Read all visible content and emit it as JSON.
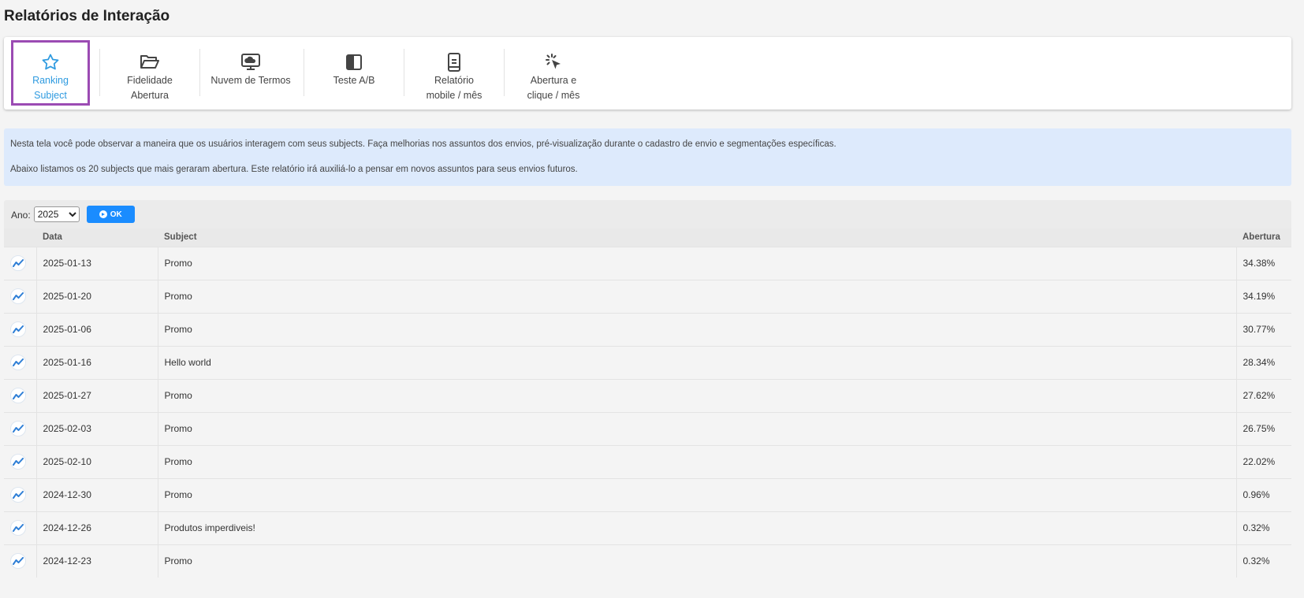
{
  "page": {
    "title": "Relatórios de Interação"
  },
  "tabs": [
    {
      "label": "Ranking\nSubject",
      "icon": "star-icon",
      "active": true
    },
    {
      "label": "Fidelidade\nAbertura",
      "icon": "folder-open-icon",
      "active": false
    },
    {
      "label": "Nuvem de Termos",
      "icon": "cloud-monitor-icon",
      "active": false
    },
    {
      "label": "Teste A/B",
      "icon": "split-square-icon",
      "active": false
    },
    {
      "label": "Relatório\nmobile / mês",
      "icon": "mobile-icon",
      "active": false
    },
    {
      "label": "Abertura e\nclique / mês",
      "icon": "cursor-click-icon",
      "active": false
    }
  ],
  "info": {
    "line1": "Nesta tela você pode observar a maneira que os usuários interagem com seus subjects. Faça melhorias nos assuntos dos envios, pré-visualização durante o cadastro de envio e segmentações específicas.",
    "line2": "Abaixo listamos os 20 subjects que mais geraram abertura. Este relatório irá auxiliá-lo a pensar em novos assuntos para seus envios futuros."
  },
  "filter": {
    "year_label": "Ano:",
    "year_value": "2025",
    "ok_label": "OK"
  },
  "colors": {
    "active_tab_border": "#9b4bb3",
    "active_tab_text": "#2f9be0",
    "ok_button": "#1a8cff",
    "info_bg": "#ddeafc"
  },
  "table": {
    "headers": {
      "date": "Data",
      "subject": "Subject",
      "opens": "Abertura"
    },
    "rows": [
      {
        "date": "2025-01-13",
        "subject": "Promo",
        "opens": "34.38%"
      },
      {
        "date": "2025-01-20",
        "subject": "Promo",
        "opens": "34.19%"
      },
      {
        "date": "2025-01-06",
        "subject": "Promo",
        "opens": "30.77%"
      },
      {
        "date": "2025-01-16",
        "subject": "Hello world",
        "opens": "28.34%"
      },
      {
        "date": "2025-01-27",
        "subject": "Promo",
        "opens": "27.62%"
      },
      {
        "date": "2025-02-03",
        "subject": "Promo",
        "opens": "26.75%"
      },
      {
        "date": "2025-02-10",
        "subject": "Promo",
        "opens": "22.02%"
      },
      {
        "date": "2024-12-30",
        "subject": "Promo",
        "opens": "0.96%"
      },
      {
        "date": "2024-12-26",
        "subject": "Produtos imperdiveis!",
        "opens": "0.32%"
      },
      {
        "date": "2024-12-23",
        "subject": "Promo",
        "opens": "0.32%"
      }
    ]
  }
}
